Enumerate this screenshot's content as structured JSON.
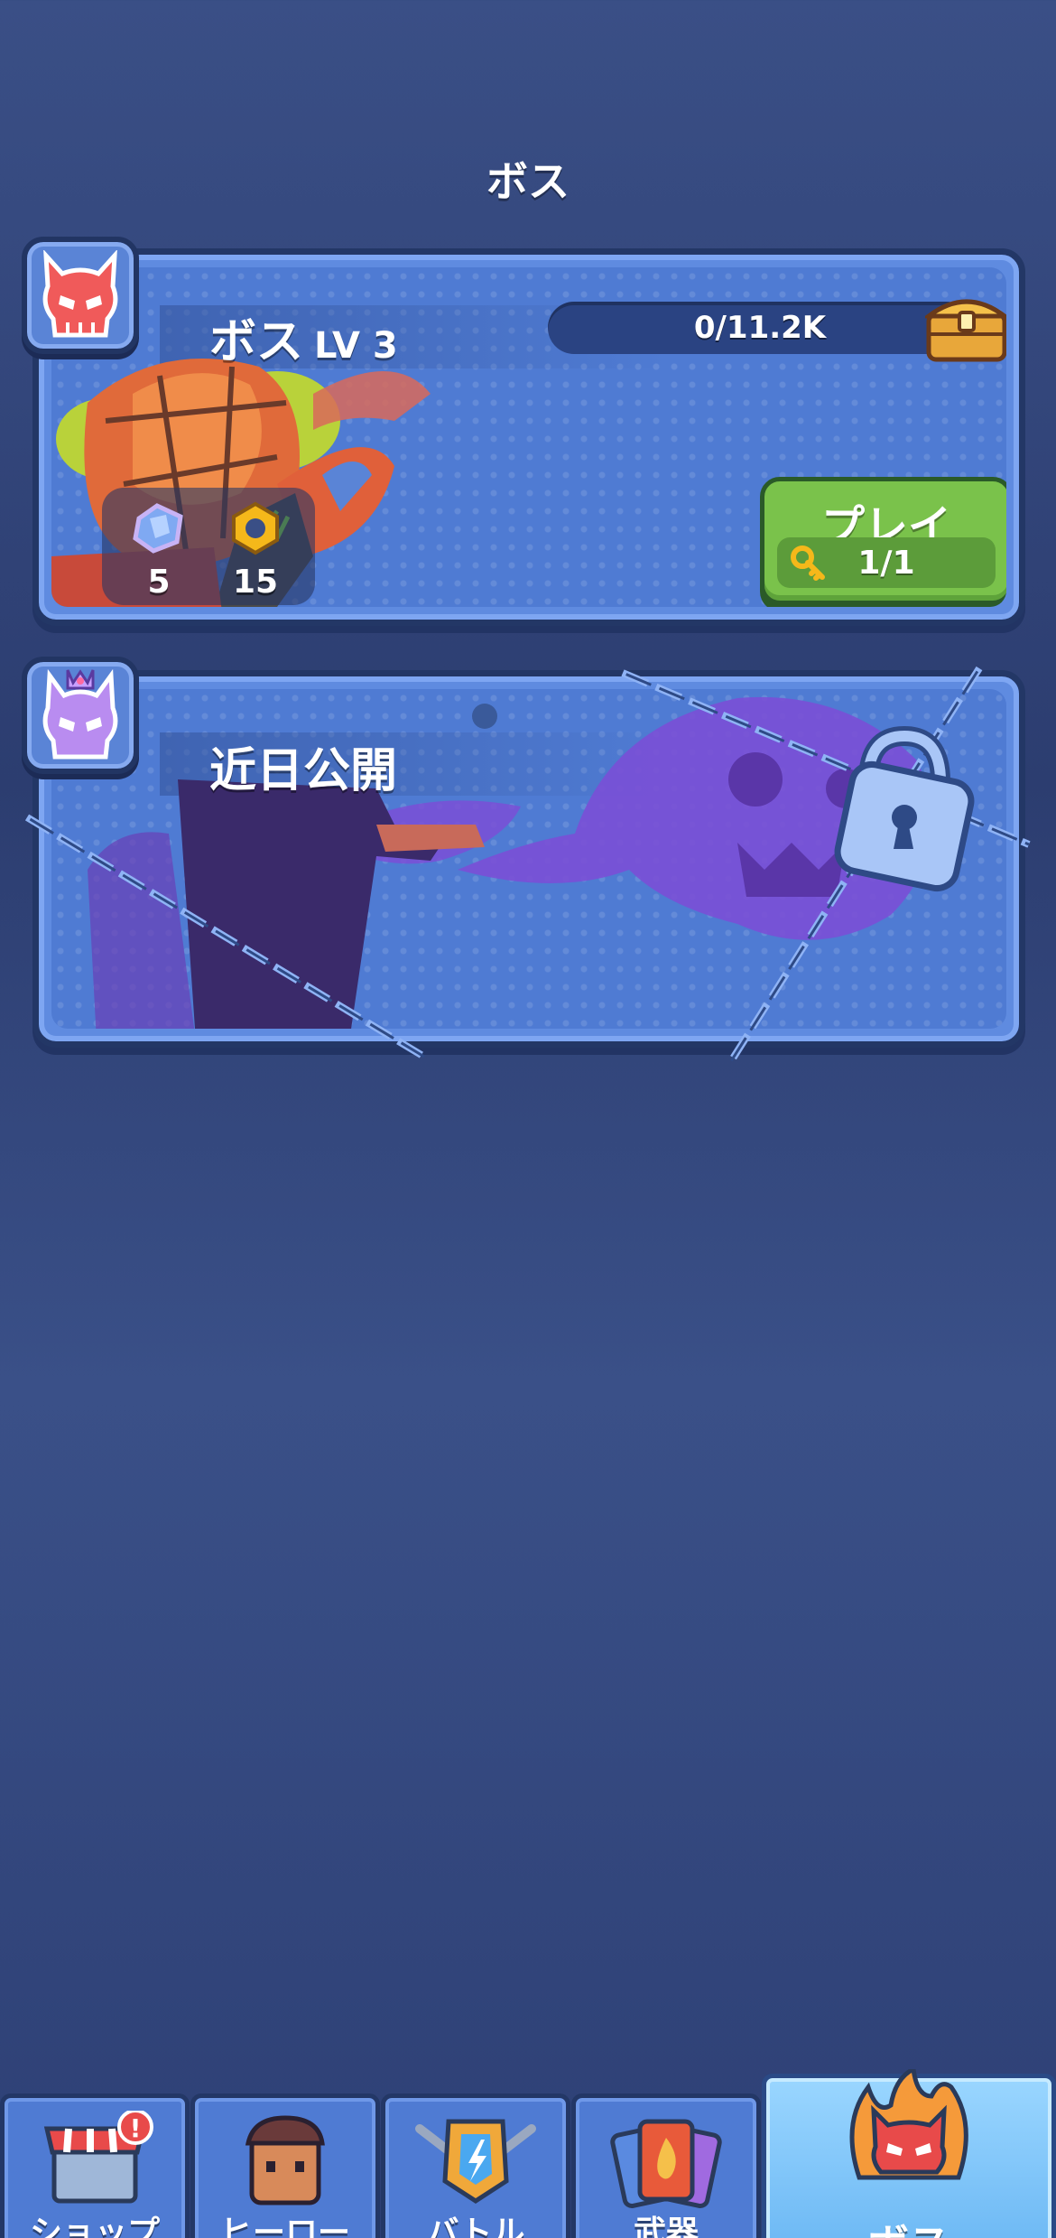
{
  "page": {
    "title": "ボス"
  },
  "boss_card": {
    "name": "ボス",
    "level": "LV 3",
    "progress_text": "0/11.2K",
    "rewards": [
      {
        "icon": "gem-icon",
        "count": "5"
      },
      {
        "icon": "gold-hexnut-icon",
        "count": "15"
      }
    ],
    "play_button": {
      "label": "プレイ",
      "keys": "1/1"
    }
  },
  "locked_card": {
    "name": "近日公開"
  },
  "nav": {
    "items": [
      {
        "label": "ショップ",
        "icon": "shop-icon",
        "active": false
      },
      {
        "label": "ヒーロー",
        "icon": "hero-icon",
        "active": false
      },
      {
        "label": "バトル",
        "icon": "battle-icon",
        "active": false
      },
      {
        "label": "武器",
        "icon": "weapon-cards-icon",
        "active": false
      },
      {
        "label": "ボス",
        "icon": "boss-flame-skull-icon",
        "active": true
      }
    ]
  },
  "colors": {
    "background": "#34497f",
    "card_fill": "#4f7bd3",
    "card_border": "#233766",
    "play_button": "#7ac24b",
    "active_tab": "#7cc4fb",
    "boss_emblem": "#f05a5a",
    "locked_emblem": "#b98cf0"
  }
}
